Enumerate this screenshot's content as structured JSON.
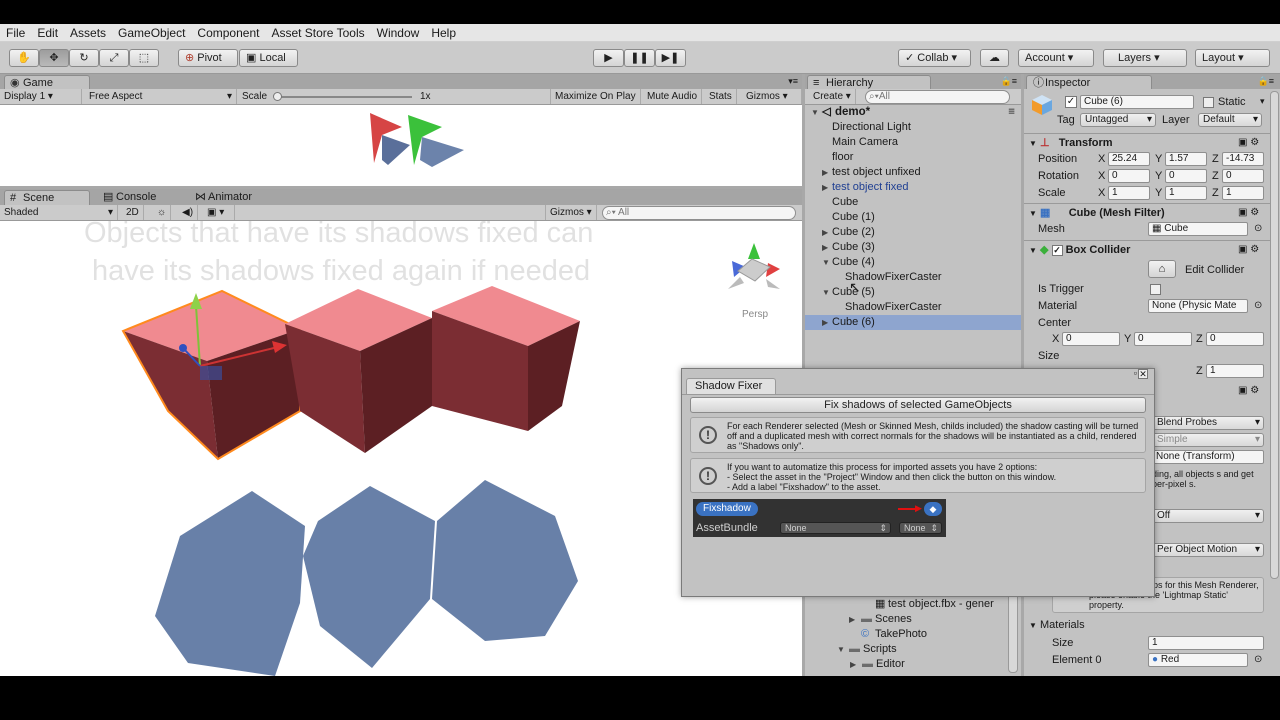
{
  "menubar": {
    "items": [
      "File",
      "Edit",
      "Assets",
      "GameObject",
      "Component",
      "Asset Store Tools",
      "Window",
      "Help"
    ]
  },
  "toolbar": {
    "pivot": "Pivot",
    "local": "Local",
    "collab": "Collab",
    "account": "Account",
    "layers": "Layers",
    "layout": "Layout"
  },
  "game": {
    "tab": "Game",
    "display": "Display 1",
    "aspect": "Free Aspect",
    "scale_label": "Scale",
    "scale_value": "1x",
    "maximize": "Maximize On Play",
    "mute": "Mute Audio",
    "stats": "Stats",
    "gizmos": "Gizmos"
  },
  "scene": {
    "tabs": [
      "Scene",
      "Console",
      "Animator"
    ],
    "shading": "Shaded",
    "mode2d": "2D",
    "gizmos": "Gizmos",
    "search": "All",
    "overlay_line1": "Objects that have its shadows fixed can",
    "overlay_line2": "have its shadows fixed again if needed",
    "persp": "Persp"
  },
  "hierarchy": {
    "tab": "Hierarchy",
    "create": "Create",
    "search": "All",
    "scene": "demo*",
    "items": [
      {
        "label": "Directional Light"
      },
      {
        "label": "Main Camera"
      },
      {
        "label": "floor"
      },
      {
        "label": "test object unfixed"
      },
      {
        "label": "test object fixed"
      },
      {
        "label": "Cube"
      },
      {
        "label": "Cube (1)"
      },
      {
        "label": "Cube (2)"
      },
      {
        "label": "Cube (3)"
      },
      {
        "label": "Cube (4)"
      },
      {
        "label": "ShadowFixerCaster"
      },
      {
        "label": "Cube (5)"
      },
      {
        "label": "ShadowFixerCaster"
      },
      {
        "label": "Cube (6)"
      }
    ],
    "project_items": [
      "test object.fbx - gener",
      "Scenes",
      "TakePhoto",
      "Scripts",
      "Editor"
    ]
  },
  "inspector": {
    "tab": "Inspector",
    "name": "Cube (6)",
    "static": "Static",
    "tag_label": "Tag",
    "tag": "Untagged",
    "layer_label": "Layer",
    "layer": "Default",
    "transform": {
      "title": "Transform",
      "position_label": "Position",
      "rotation_label": "Rotation",
      "scale_label": "Scale",
      "position": [
        "25.24",
        "1.57",
        "-14.73"
      ],
      "rotation": [
        "0",
        "0",
        "0"
      ],
      "scale": [
        "1",
        "1",
        "1"
      ]
    },
    "mesh_filter": {
      "title": "Cube (Mesh Filter)",
      "mesh_label": "Mesh",
      "mesh": "Cube"
    },
    "box_collider": {
      "title": "Box Collider",
      "edit": "Edit Collider",
      "trigger_label": "Is Trigger",
      "material_label": "Material",
      "material": "None (Physic Mate",
      "center_label": "Center",
      "center": [
        "0",
        "0",
        "0"
      ],
      "size_label": "Size",
      "size_z": "1"
    },
    "renderer_partial": {
      "probes": "Blend Probes",
      "simple": "Simple",
      "anchor": "None (Transform)",
      "note": "ding, all objects s and get per-pixel s.",
      "off": "Off",
      "motion": "Per Object Motion",
      "lightmap_note": "ration of lightmaps for this Mesh Renderer, please enable the 'Lightmap Static' property."
    },
    "materials": {
      "title": "Materials",
      "size_label": "Size",
      "size": "1",
      "element_label": "Element 0",
      "element": "Red"
    },
    "axis": [
      "X",
      "Y",
      "Z"
    ]
  },
  "dialog": {
    "title": "Shadow Fixer",
    "button": "Fix shadows of selected GameObjects",
    "info1": "For each Renderer selected (Mesh or Skinned Mesh, childs included) the shadow casting will be turned off and a duplicated mesh with correct normals for the shadows will be instantiated as a child, rendered as \"Shadows only\".",
    "info2_l1": "If you want to automatize this process for imported assets you have 2 options:",
    "info2_l2": "- Select the asset in the \"Project\" Window and then click the button on this window.",
    "info2_l3": "- Add a label \"Fixshadow\" to the asset.",
    "label_chip": "Fixshadow",
    "assetbundle_label": "AssetBundle",
    "assetbundle_value": "None",
    "variant_value": "None"
  },
  "colors": {
    "accent_blue": "#3a72c2",
    "selection": "#8ea5cf",
    "cube_red": "#e85b64",
    "shadow_blue": "#6880a8"
  }
}
